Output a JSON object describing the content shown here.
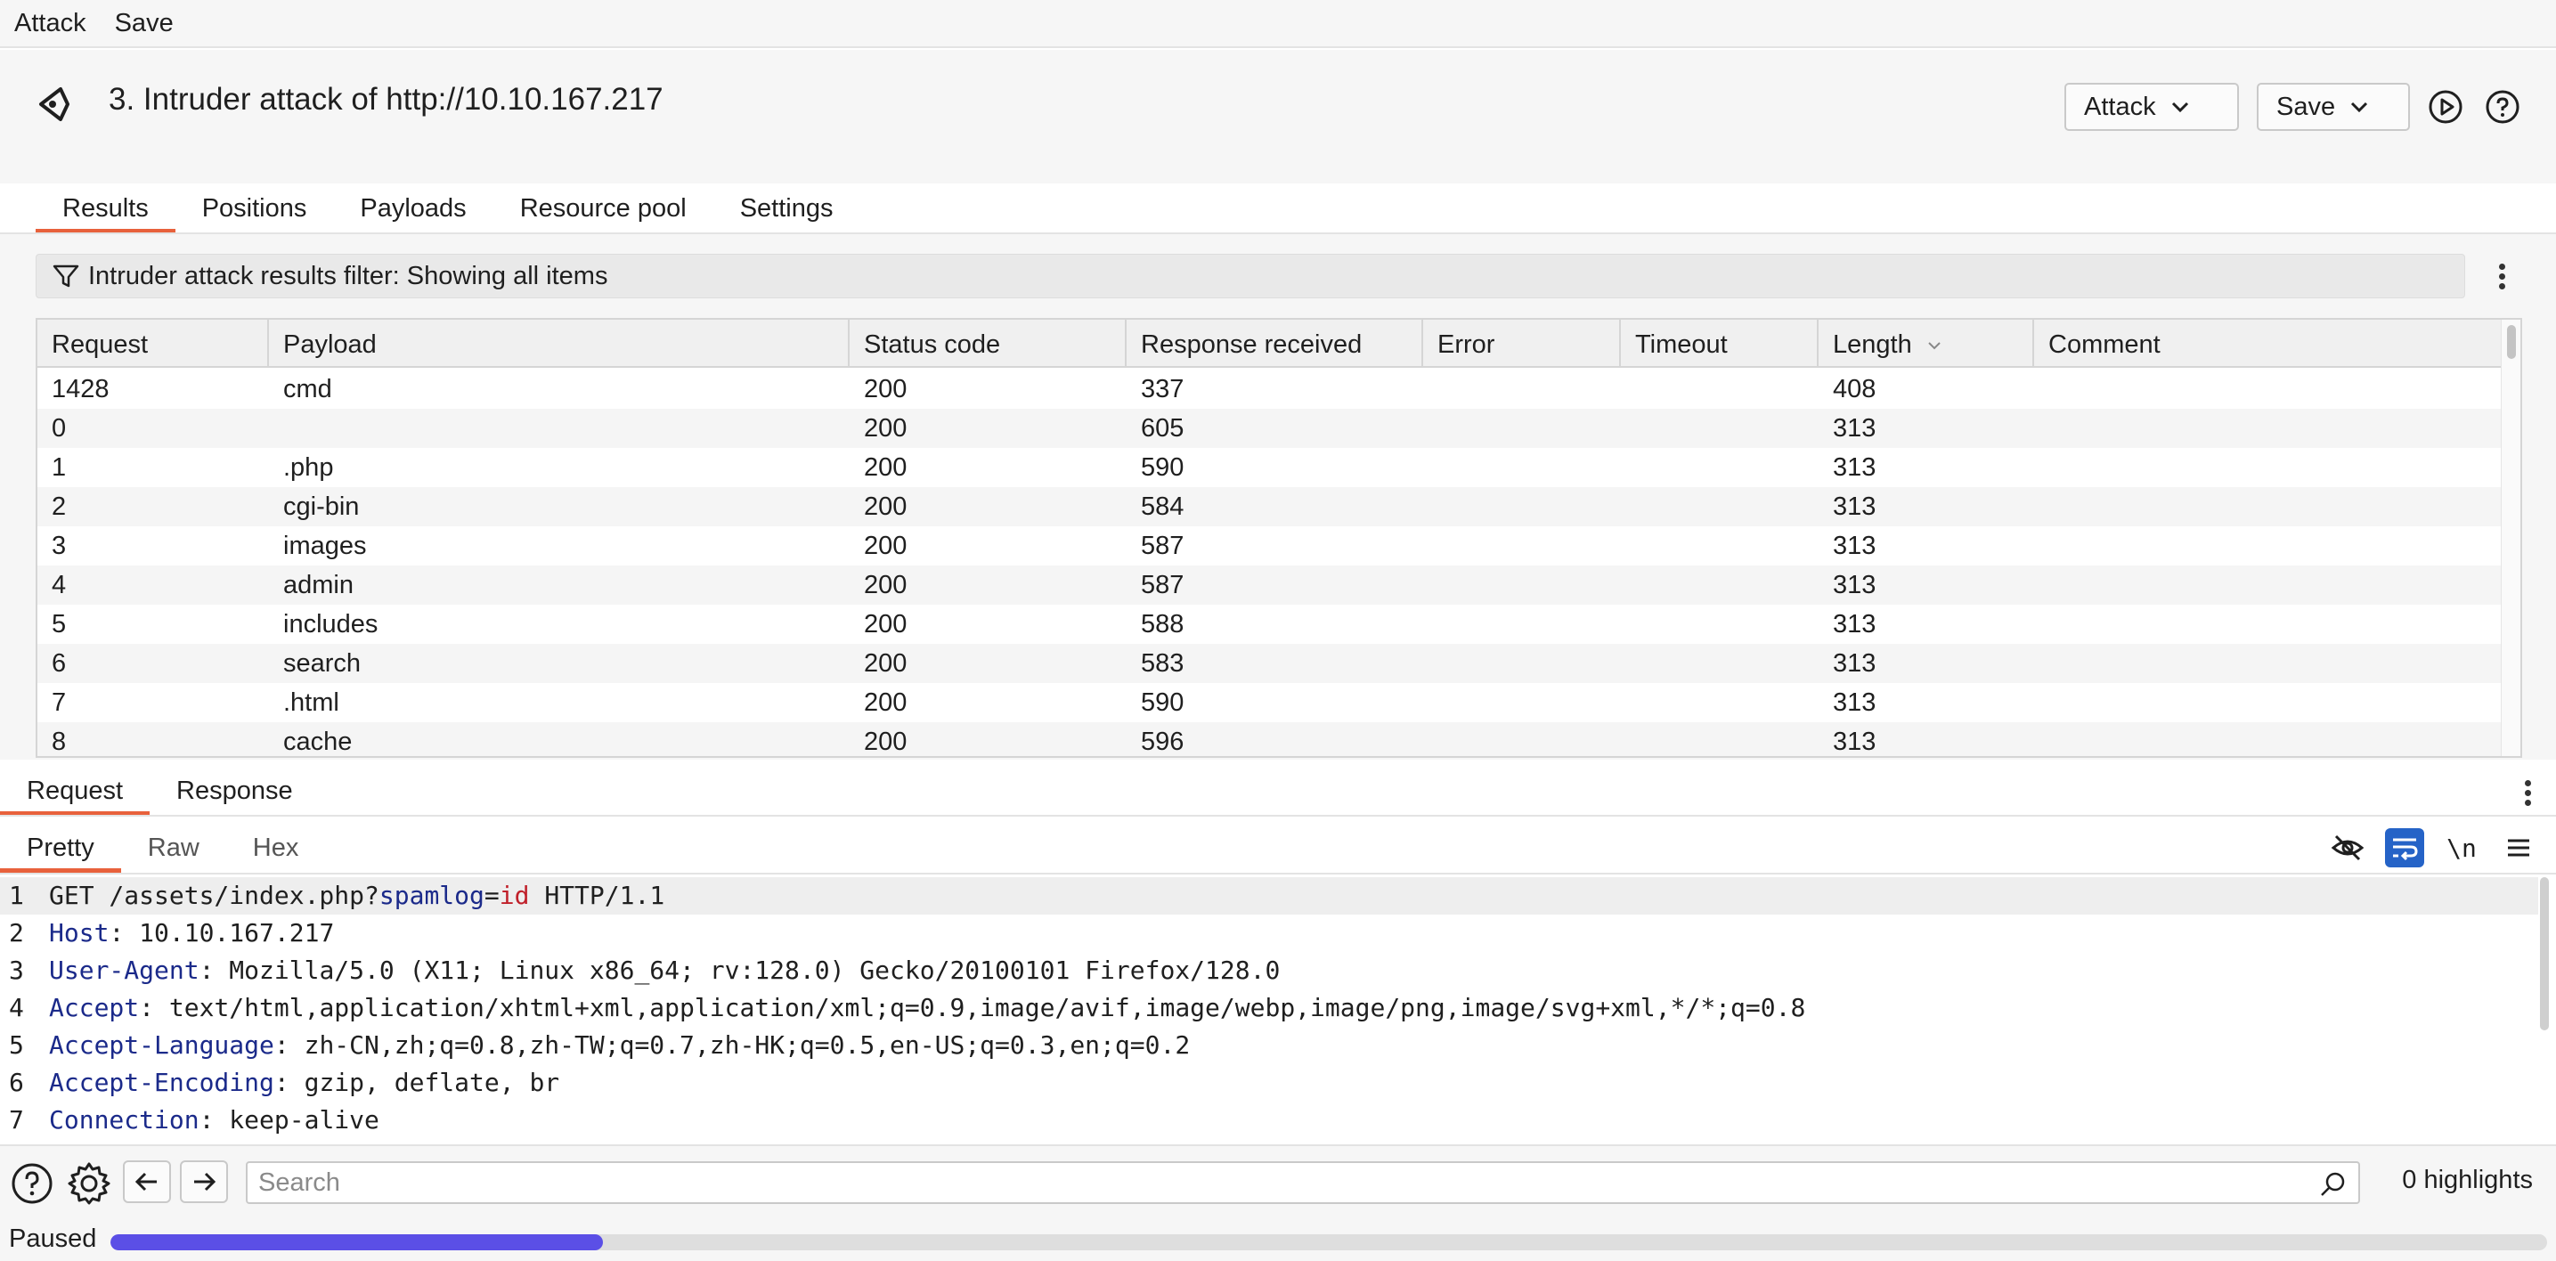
{
  "menubar": {
    "items": [
      "Attack",
      "Save"
    ]
  },
  "header": {
    "title": "3. Intruder attack of http://10.10.167.217",
    "attack_button": "Attack",
    "save_button": "Save"
  },
  "tabs": [
    "Results",
    "Positions",
    "Payloads",
    "Resource pool",
    "Settings"
  ],
  "active_tab": "Results",
  "filter": {
    "text": "Intruder attack results filter: Showing all items"
  },
  "table": {
    "columns": [
      "Request",
      "Payload",
      "Status code",
      "Response received",
      "Error",
      "Timeout",
      "Length",
      "Comment"
    ],
    "sorted_column": "Length",
    "rows": [
      [
        "1428",
        "cmd",
        "200",
        "337",
        "",
        "",
        "408",
        ""
      ],
      [
        "0",
        "",
        "200",
        "605",
        "",
        "",
        "313",
        ""
      ],
      [
        "1",
        ".php",
        "200",
        "590",
        "",
        "",
        "313",
        ""
      ],
      [
        "2",
        "cgi-bin",
        "200",
        "584",
        "",
        "",
        "313",
        ""
      ],
      [
        "3",
        "images",
        "200",
        "587",
        "",
        "",
        "313",
        ""
      ],
      [
        "4",
        "admin",
        "200",
        "587",
        "",
        "",
        "313",
        ""
      ],
      [
        "5",
        "includes",
        "200",
        "588",
        "",
        "",
        "313",
        ""
      ],
      [
        "6",
        "search",
        "200",
        "583",
        "",
        "",
        "313",
        ""
      ],
      [
        "7",
        ".html",
        "200",
        "590",
        "",
        "",
        "313",
        ""
      ],
      [
        "8",
        "cache",
        "200",
        "596",
        "",
        "",
        "313",
        ""
      ]
    ]
  },
  "message_tabs": [
    "Request",
    "Response"
  ],
  "view_tabs": [
    "Pretty",
    "Raw",
    "Hex"
  ],
  "editor_tools": {
    "newline_label": "\\n"
  },
  "request_lines": [
    {
      "n": "1",
      "parts": [
        {
          "t": "GET /assets/index.php?",
          "c": "plain"
        },
        {
          "t": "spamlog",
          "c": "pn"
        },
        {
          "t": "=",
          "c": "plain"
        },
        {
          "t": "id",
          "c": "pv"
        },
        {
          "t": " HTTP/1.1",
          "c": "plain"
        }
      ]
    },
    {
      "n": "2",
      "parts": [
        {
          "t": "Host",
          "c": "hn"
        },
        {
          "t": ": 10.10.167.217",
          "c": "plain"
        }
      ]
    },
    {
      "n": "3",
      "parts": [
        {
          "t": "User-Agent",
          "c": "hn"
        },
        {
          "t": ": Mozilla/5.0 (X11; Linux x86_64; rv:128.0) Gecko/20100101 Firefox/128.0",
          "c": "plain"
        }
      ]
    },
    {
      "n": "4",
      "parts": [
        {
          "t": "Accept",
          "c": "hn"
        },
        {
          "t": ": text/html,application/xhtml+xml,application/xml;q=0.9,image/avif,image/webp,image/png,image/svg+xml,*/*;q=0.8",
          "c": "plain"
        }
      ]
    },
    {
      "n": "5",
      "parts": [
        {
          "t": "Accept-Language",
          "c": "hn"
        },
        {
          "t": ": zh-CN,zh;q=0.8,zh-TW;q=0.7,zh-HK;q=0.5,en-US;q=0.3,en;q=0.2",
          "c": "plain"
        }
      ]
    },
    {
      "n": "6",
      "parts": [
        {
          "t": "Accept-Encoding",
          "c": "hn"
        },
        {
          "t": ": gzip, deflate, br",
          "c": "plain"
        }
      ]
    },
    {
      "n": "7",
      "parts": [
        {
          "t": "Connection",
          "c": "hn"
        },
        {
          "t": ": keep-alive",
          "c": "plain"
        }
      ]
    }
  ],
  "search": {
    "placeholder": "Search",
    "highlights": "0 highlights"
  },
  "status": {
    "text": "Paused",
    "progress": 0.202
  },
  "colors": {
    "accent": "#e8613c",
    "progress": "#5b4fe6",
    "header_name": "#1b2a8a",
    "param_value": "#c0202a",
    "wrap_button": "#2563c7"
  }
}
